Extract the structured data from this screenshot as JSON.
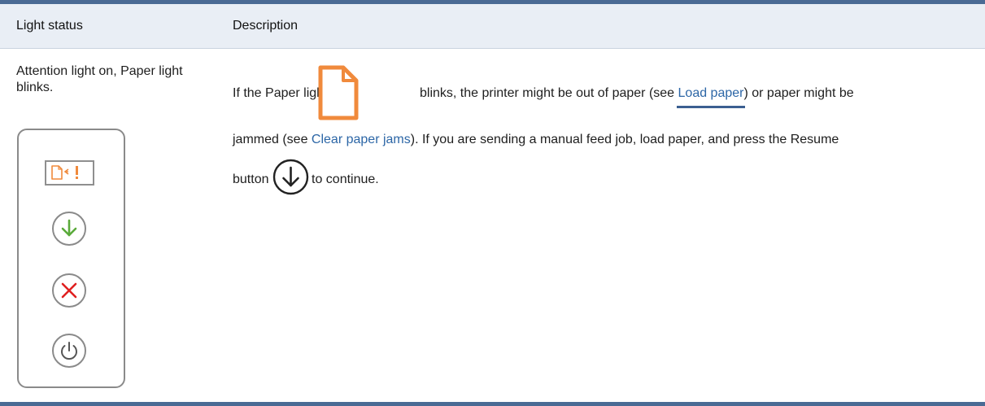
{
  "table": {
    "headers": {
      "light_status": "Light status",
      "description": "Description"
    },
    "row": {
      "light_status": "Attention light on, Paper light blinks.",
      "desc": {
        "part1": "If the Paper light",
        "part2": "blinks, the printer might be out of paper (see ",
        "link_load": "Load paper",
        "part3": ") or paper might be",
        "part4": "jammed (see ",
        "link_jams": "Clear paper jams",
        "part5": "). If you are sending a manual feed job, load paper, and press the Resume",
        "part6": "button",
        "part7": "to continue."
      }
    }
  },
  "colors": {
    "header_bg": "#e9eef5",
    "rule": "#4a6a94",
    "attention_orange": "#f08a3c",
    "resume_green": "#5aaa3a",
    "cancel_red": "#e02020",
    "link": "#2c66a6"
  },
  "icons": {
    "paper_light": "paper-light-icon",
    "resume": "resume-arrow-icon",
    "panel_resume": "resume-arrow-icon",
    "panel_cancel": "cancel-x-icon",
    "panel_power": "power-icon",
    "panel_attention": "attention-exclamation-icon"
  }
}
